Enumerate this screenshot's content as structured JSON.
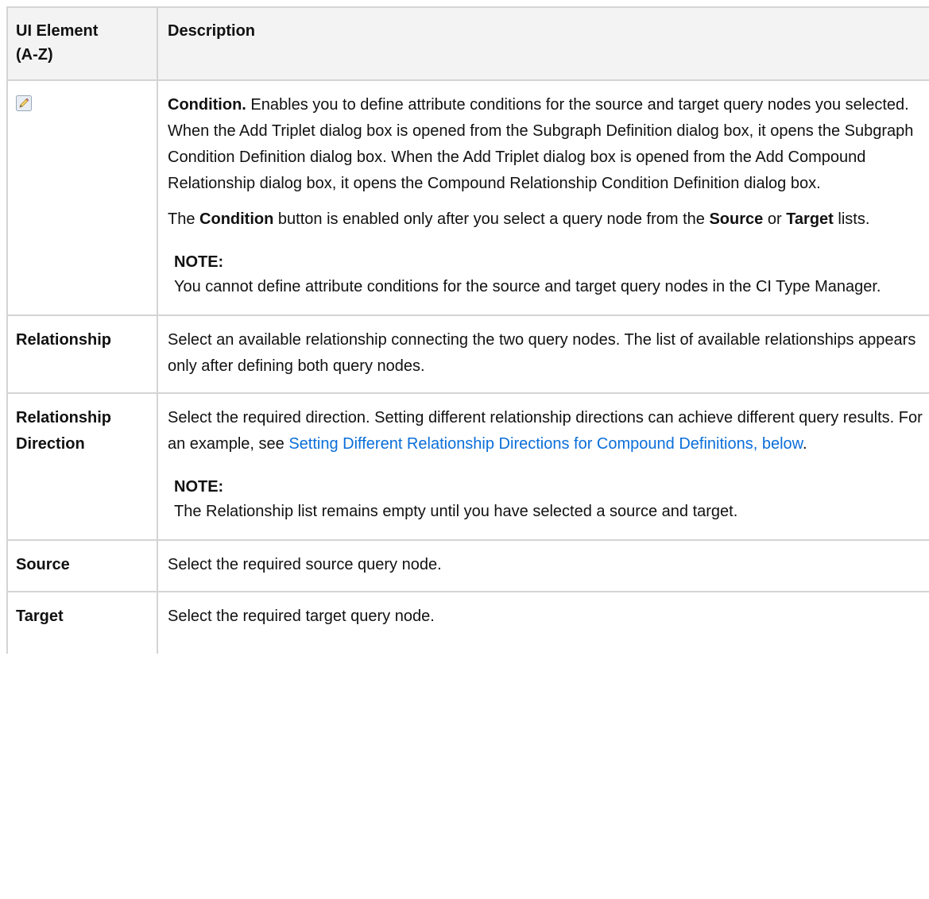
{
  "table": {
    "header": {
      "col1_line1": "UI Element",
      "col1_line2": "(A-Z)",
      "col2": "Description"
    },
    "rows": [
      {
        "element_icon": "pencil-icon",
        "desc_bold": "Condition.",
        "desc_text": " Enables you to define attribute conditions for the source and target query nodes you selected. When the Add Triplet dialog box is opened from the Subgraph Definition dialog box, it opens the Subgraph Condition Definition dialog box. When the Add Triplet dialog box is opened from the Add Compound Relationship dialog box, it opens the Compound Relationship Condition Definition dialog box.",
        "para2_a": "The ",
        "para2_b": "Condition",
        "para2_c": " button is enabled only after you select a query node from the ",
        "para2_d": "Source",
        "para2_e": " or ",
        "para2_f": "Target",
        "para2_g": " lists.",
        "note_title": "NOTE:",
        "note_text": "You cannot define attribute conditions for the source and target query nodes in the CI Type Manager."
      },
      {
        "element": "Relationship",
        "desc": "Select an available relationship connecting the two query nodes. The list of available relationships appears only after defining both query nodes."
      },
      {
        "element_line1": "Relationship",
        "element_line2": "Direction",
        "desc_text": "Select the required direction. Setting different relationship directions can achieve different query results. For an example, see ",
        "desc_link": "Setting Different Relationship Directions for Compound Definitions, below",
        "desc_end": ".",
        "note_title": "NOTE:",
        "note_text": "The Relationship list remains empty until you have selected a source and target."
      },
      {
        "element": "Source",
        "desc": "Select the required source query node."
      },
      {
        "element": "Target",
        "desc": "Select the required target query node."
      }
    ]
  },
  "colors": {
    "header_bg": "#f3f3f3",
    "border": "#d4d4d4",
    "link": "#0a6ed9"
  }
}
